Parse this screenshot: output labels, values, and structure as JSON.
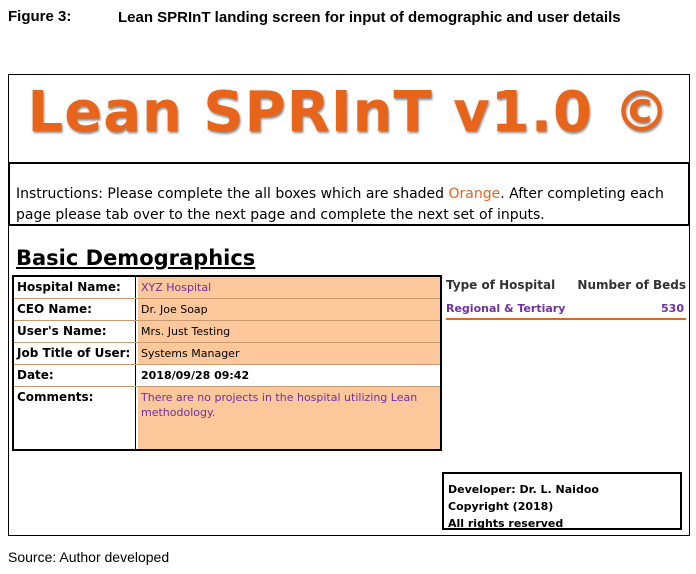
{
  "caption": {
    "label": "Figure 3:",
    "title": "Lean SPRInT landing screen for input of demographic and user details"
  },
  "app": {
    "title": "Lean SPRInT v1.0 ©"
  },
  "instructions": {
    "before": "Instructions: Please complete the all boxes which are shaded ",
    "highlight": "Orange",
    "after": ". After completing each page please tab over to the next page and complete the next set of inputs."
  },
  "section": {
    "title": "Basic Demographics"
  },
  "form": {
    "hospital_name": {
      "label": "Hospital Name:",
      "value": "XYZ Hospital"
    },
    "ceo_name": {
      "label": "CEO Name:",
      "value": "Dr. Joe Soap"
    },
    "user_name": {
      "label": "User's Name:",
      "value": "Mrs. Just Testing"
    },
    "job_title": {
      "label": "Job Title of User:",
      "value": "Systems Manager"
    },
    "date": {
      "label": "Date:",
      "value": "2018/09/28 09:42"
    },
    "comments": {
      "label": "Comments:",
      "value": "There are no projects in the hospital utilizing Lean methodology."
    }
  },
  "hospital_table": {
    "headers": {
      "type": "Type of Hospital",
      "beds": "Number of Beds"
    },
    "row": {
      "type": "Regional & Tertiary",
      "beds": "530"
    }
  },
  "developer": {
    "line1": "Developer: Dr. L. Naidoo",
    "line2": "Copyright (2018)",
    "line3": "All rights reserved"
  },
  "source": {
    "text": "Source:  Author developed"
  },
  "colors": {
    "accent_orange": "#e8641b",
    "input_fill": "#fbc79b",
    "value_purple": "#7030a0"
  }
}
